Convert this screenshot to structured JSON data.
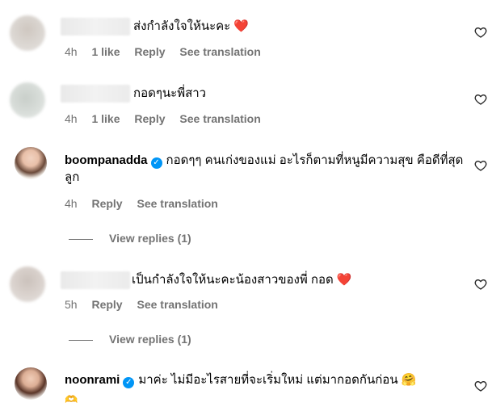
{
  "comments": [
    {
      "username": "",
      "verified": false,
      "text": "ส่งกำลังใจให้นะคะ",
      "emoji": "❤️",
      "time": "4h",
      "likes": "1 like",
      "reply": "Reply",
      "translate": "See translation"
    },
    {
      "username": "",
      "verified": false,
      "text": "กอดๆนะพี่สาว",
      "emoji": "",
      "time": "4h",
      "likes": "1 like",
      "reply": "Reply",
      "translate": "See translation"
    },
    {
      "username": "boompanadda",
      "verified": true,
      "text": "กอดๆๆ คนเก่งของแม่ อะไรก็ตามที่หนูมีความสุข คือดีที่สุดลูก",
      "emoji": "",
      "time": "4h",
      "reply": "Reply",
      "translate": "See translation",
      "view_replies": "View replies (1)"
    },
    {
      "username": "",
      "verified": false,
      "text": "เป็นกำลังใจให้นะคะน้องสาวของพี่ กอด",
      "emoji": "❤️",
      "time": "5h",
      "reply": "Reply",
      "translate": "See translation",
      "view_replies": "View replies (1)"
    },
    {
      "username": "noonrami",
      "verified": true,
      "text": "มาค่ะ ไม่มีอะไรสายที่จะเริ่มใหม่ แต่มากอดกันก่อน",
      "emoji": "🤗",
      "extra_emoji": "🫶"
    }
  ],
  "icons": {
    "like": "heart-outline-icon",
    "verified": "verified-badge-icon"
  },
  "colors": {
    "verified": "#0095f6",
    "meta": "#737373",
    "heart_emoji": "#e0245e"
  }
}
